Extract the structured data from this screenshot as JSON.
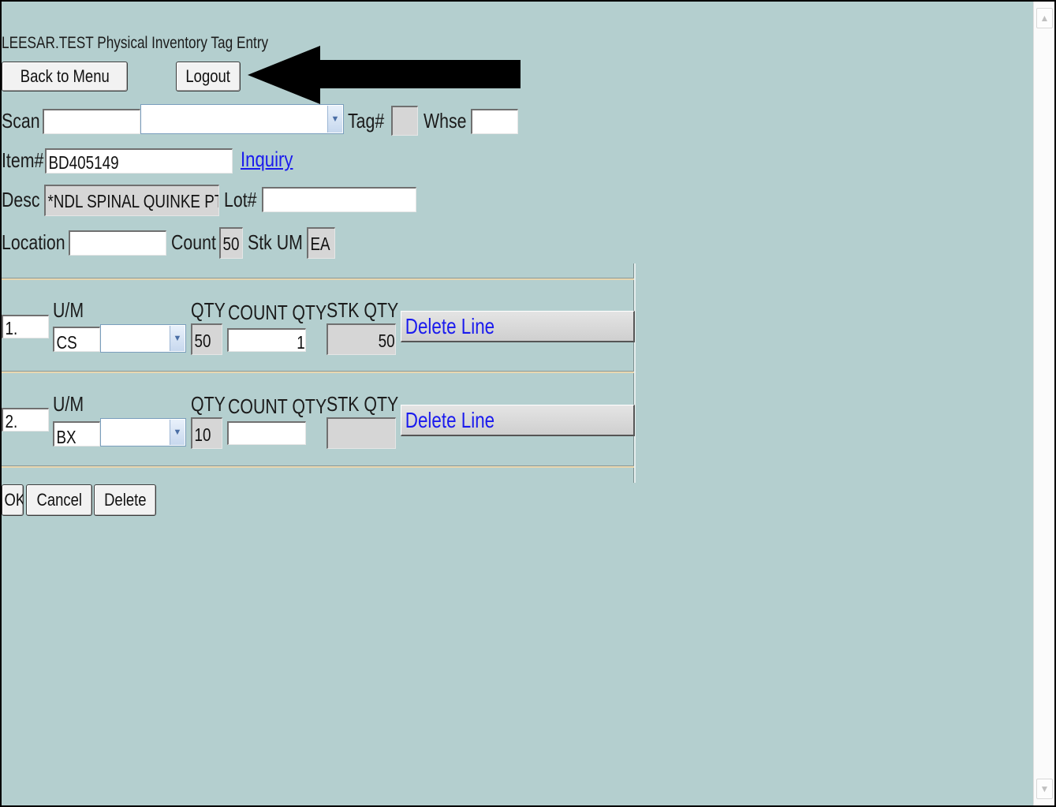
{
  "page": {
    "title": "LEESAR.TEST Physical Inventory Tag Entry"
  },
  "nav": {
    "back_label": "Back to Menu",
    "logout_label": "Logout"
  },
  "annotation": {
    "icon": "left-arrow-icon",
    "color": "#000000"
  },
  "form": {
    "scan_label": "Scan",
    "scan_value": "",
    "scan_select_value": "",
    "tag_label": "Tag#",
    "tag_value": "",
    "whse_label": "Whse",
    "whse_value": "",
    "item_label": "Item#",
    "item_value": "BD405149",
    "inquiry_link": "Inquiry",
    "desc_label": "Desc",
    "desc_value": "*NDL SPINAL QUINKE PT",
    "lot_label": "Lot#",
    "lot_value": "",
    "location_label": "Location",
    "location_value": "",
    "count_label": "Count",
    "count_value": "50",
    "stkum_label": "Stk UM",
    "stkum_value": "EA"
  },
  "lines": [
    {
      "line_no": "1.",
      "um_label": "U/M",
      "um_value": "CS",
      "um_select_value": "",
      "qty_label": "QTY",
      "qty_value": "50",
      "count_qty_label": "COUNT QTY",
      "count_qty_value": "1",
      "stk_qty_label": "STK QTY",
      "stk_qty_value": "50",
      "delete_label": "Delete Line"
    },
    {
      "line_no": "2.",
      "um_label": "U/M",
      "um_value": "BX",
      "um_select_value": "",
      "qty_label": "QTY",
      "qty_value": "10",
      "count_qty_label": "COUNT QTY",
      "count_qty_value": "",
      "stk_qty_label": "STK QTY",
      "stk_qty_value": "",
      "delete_label": "Delete Line"
    }
  ],
  "actions": {
    "ok_label": "OK",
    "cancel_label": "Cancel",
    "delete_label": "Delete"
  },
  "colors": {
    "background": "#b4cfcf",
    "link": "#1a1aee"
  }
}
